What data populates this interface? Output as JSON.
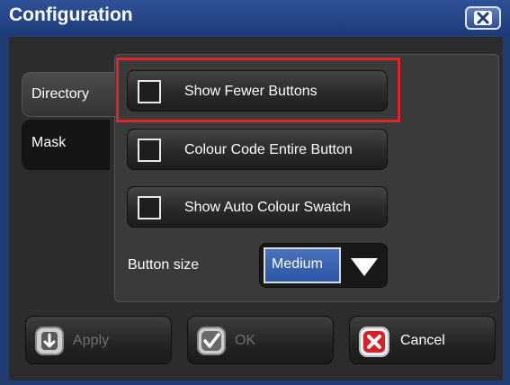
{
  "window": {
    "title": "Configuration"
  },
  "tabs": [
    {
      "label": "Directory",
      "selected": true
    },
    {
      "label": "Mask",
      "selected": false
    }
  ],
  "options": [
    {
      "label": "Show Fewer Buttons",
      "checked": false,
      "highlighted": true
    },
    {
      "label": "Colour Code Entire Button",
      "checked": false
    },
    {
      "label": "Show Auto Colour Swatch",
      "checked": false
    }
  ],
  "button_size": {
    "label": "Button size",
    "value": "Medium"
  },
  "buttons": {
    "apply": {
      "label": "Apply",
      "enabled": false
    },
    "ok": {
      "label": "OK",
      "enabled": false
    },
    "cancel": {
      "label": "Cancel",
      "enabled": true
    }
  },
  "colors": {
    "title_bar": "#2f5197",
    "highlight": "#e0242c",
    "select_value_bg": "#3a66b4",
    "cancel_icon": "#d92027"
  }
}
